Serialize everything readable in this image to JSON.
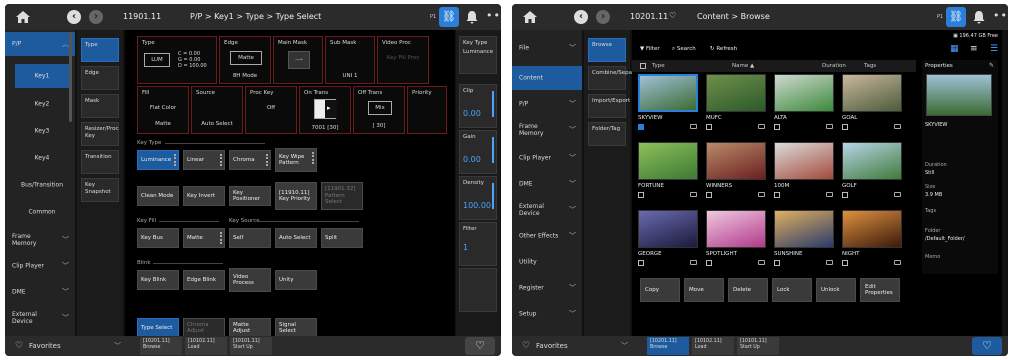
{
  "left": {
    "title_id": "11901.11",
    "breadcrumb": "P/P > Key1 > Type > Type Select",
    "p1_label": "P1",
    "sidebar": [
      {
        "label": "P/P",
        "selected": true,
        "chevron": "^"
      },
      {
        "label": "Key1",
        "sub": true,
        "selected": true
      },
      {
        "label": "Key2",
        "sub": true
      },
      {
        "label": "Key3",
        "sub": true
      },
      {
        "label": "Key4",
        "sub": true
      },
      {
        "label": "Bus/Transition",
        "sub": true
      },
      {
        "label": "Common",
        "sub": true
      },
      {
        "label": "Frame Memory",
        "chevron": "v"
      },
      {
        "label": "Clip Player",
        "chevron": "v"
      },
      {
        "label": "DME",
        "chevron": "v"
      },
      {
        "label": "External Device",
        "chevron": "v"
      }
    ],
    "tabs": [
      "Type",
      "Edge",
      "Mask",
      "Resizer/Proc Key",
      "Transition",
      "Key Snapshot"
    ],
    "params": {
      "type": {
        "title": "Type",
        "value": "LUM",
        "c": "C",
        "g": "G",
        "d": "D",
        "c_val": "= 0.00",
        "g_val": "= 0.00",
        "d_val": "= 100.00"
      },
      "edge": {
        "title": "Edge",
        "value": "Matte",
        "sub": "8H Mode"
      },
      "main_mask": {
        "title": "Main Mask"
      },
      "sub_mask": {
        "title": "Sub Mask",
        "value": "UNI 1"
      },
      "video_proc": {
        "title": "Video Proc",
        "value": "Key Fill Proc"
      },
      "fill": {
        "title": "Fill",
        "value": "Flat Color",
        "sub": "Matte"
      },
      "source": {
        "title": "Source",
        "value": "Auto Select"
      },
      "proc_key": {
        "title": "Proc Key",
        "value": "Off"
      },
      "on_trans": {
        "title": "On Trans",
        "value": "7001 [30]"
      },
      "off_trans": {
        "title": "Off Trans",
        "value": "Mix",
        "sub": "[ 30]"
      },
      "priority": {
        "title": "Priority"
      }
    },
    "key_type_group": "Key Type",
    "key_type_buttons": [
      "Luminance",
      "Linear",
      "Chroma",
      "Key Wipe Pattern"
    ],
    "row2_buttons": [
      "Clean Mode",
      "Key Invert",
      "Key Positioner",
      "[11910.11] Key Priority",
      "[11901.32] Pattern Select"
    ],
    "key_fill_group": "Key Fill",
    "key_source_group": "Key Source",
    "row3_buttons": [
      "Key Bus",
      "Matte",
      "Self",
      "Auto Select",
      "Split"
    ],
    "blink_group": "Blink",
    "row4_buttons": [
      "Key Blink",
      "Edge Blink",
      "Video Process",
      "Unity"
    ],
    "bottom_buttons": [
      "Type Select",
      "Chroma Adjust",
      "Matte Adjust",
      "Signal Select"
    ],
    "right_col": [
      {
        "title": "Key Type",
        "value": "Luminance"
      },
      {
        "title": "Clip",
        "value": "0.00"
      },
      {
        "title": "Gain",
        "value": "0.00"
      },
      {
        "title": "Density",
        "value": "100.00"
      },
      {
        "title": "Filter",
        "value": "1"
      }
    ],
    "favorites": "Favorites",
    "shortcuts": [
      "[10201.11] Browse",
      "[10102.11] Load",
      "[10101.11] Start Up"
    ]
  },
  "right": {
    "title_id": "10201.11",
    "breadcrumb": "Content > Browse",
    "p1_label": "P1",
    "free_space": "196.47 GB Free",
    "sidebar": [
      {
        "label": "File",
        "chevron": "v"
      },
      {
        "label": "Content",
        "selected": true
      },
      {
        "label": "P/P",
        "chevron": "v"
      },
      {
        "label": "Frame Memory",
        "chevron": "v"
      },
      {
        "label": "Clip Player",
        "chevron": "v"
      },
      {
        "label": "DME",
        "chevron": "v"
      },
      {
        "label": "External Device",
        "chevron": "v"
      },
      {
        "label": "Other Effects",
        "chevron": "v"
      },
      {
        "label": "Utility"
      },
      {
        "label": "Register",
        "chevron": "v"
      },
      {
        "label": "Setup",
        "chevron": "v"
      }
    ],
    "tabs": [
      "Browse",
      "Combine/Separate",
      "Import/Export",
      "Folder/Tag"
    ],
    "toolbar": {
      "filter": "Filter",
      "search": "Search",
      "refresh": "Refresh"
    },
    "columns": {
      "type": "Type",
      "name": "Name ▲",
      "duration": "Duration",
      "tags": "Tags"
    },
    "thumbs": [
      {
        "name": "SKYVIEW",
        "checked": true,
        "colors": [
          "#3b6b34",
          "#9fc0d6"
        ]
      },
      {
        "name": "MUFC",
        "colors": [
          "#2c5a2a",
          "#6e8f4a"
        ]
      },
      {
        "name": "ALTA",
        "colors": [
          "#3a8a3a",
          "#d0d8d0"
        ]
      },
      {
        "name": "GOAL",
        "colors": [
          "#4c5b3a",
          "#c9b79c"
        ]
      },
      {
        "name": "FORTUNE",
        "colors": [
          "#3c7a34",
          "#8dbf5a"
        ]
      },
      {
        "name": "WINNERS",
        "colors": [
          "#6b1f1f",
          "#b98a6a"
        ]
      },
      {
        "name": "100M",
        "colors": [
          "#a24a3a",
          "#dcdcdc"
        ]
      },
      {
        "name": "GOLF",
        "colors": [
          "#3f7c3a",
          "#b7d3e6"
        ]
      },
      {
        "name": "GEORGE",
        "colors": [
          "#1a1a3a",
          "#6a6ab0"
        ]
      },
      {
        "name": "SPOTLIGHT",
        "colors": [
          "#b03a8a",
          "#f0c8e0"
        ]
      },
      {
        "name": "SUNSHINE",
        "colors": [
          "#2a3a6a",
          "#e0b060"
        ]
      },
      {
        "name": "NIGHT",
        "colors": [
          "#3a1a0a",
          "#e09040"
        ]
      }
    ],
    "properties": {
      "title": "Properties",
      "name": "SKYVIEW",
      "duration_label": "Duration",
      "duration_value": "Still",
      "size_label": "Size",
      "size_value": "3.9 MB",
      "tags_label": "Tags",
      "folder_label": "Folder",
      "folder_value": "/Default_Folder/",
      "memo_label": "Memo"
    },
    "actions": [
      "Copy",
      "Move",
      "Delete",
      "Lock",
      "Unlock",
      "Edit Properties"
    ],
    "favorites": "Favorites",
    "shortcuts": [
      "[10201.11] Browse",
      "[10102.11] Load",
      "[10101.11] Start Up"
    ]
  }
}
